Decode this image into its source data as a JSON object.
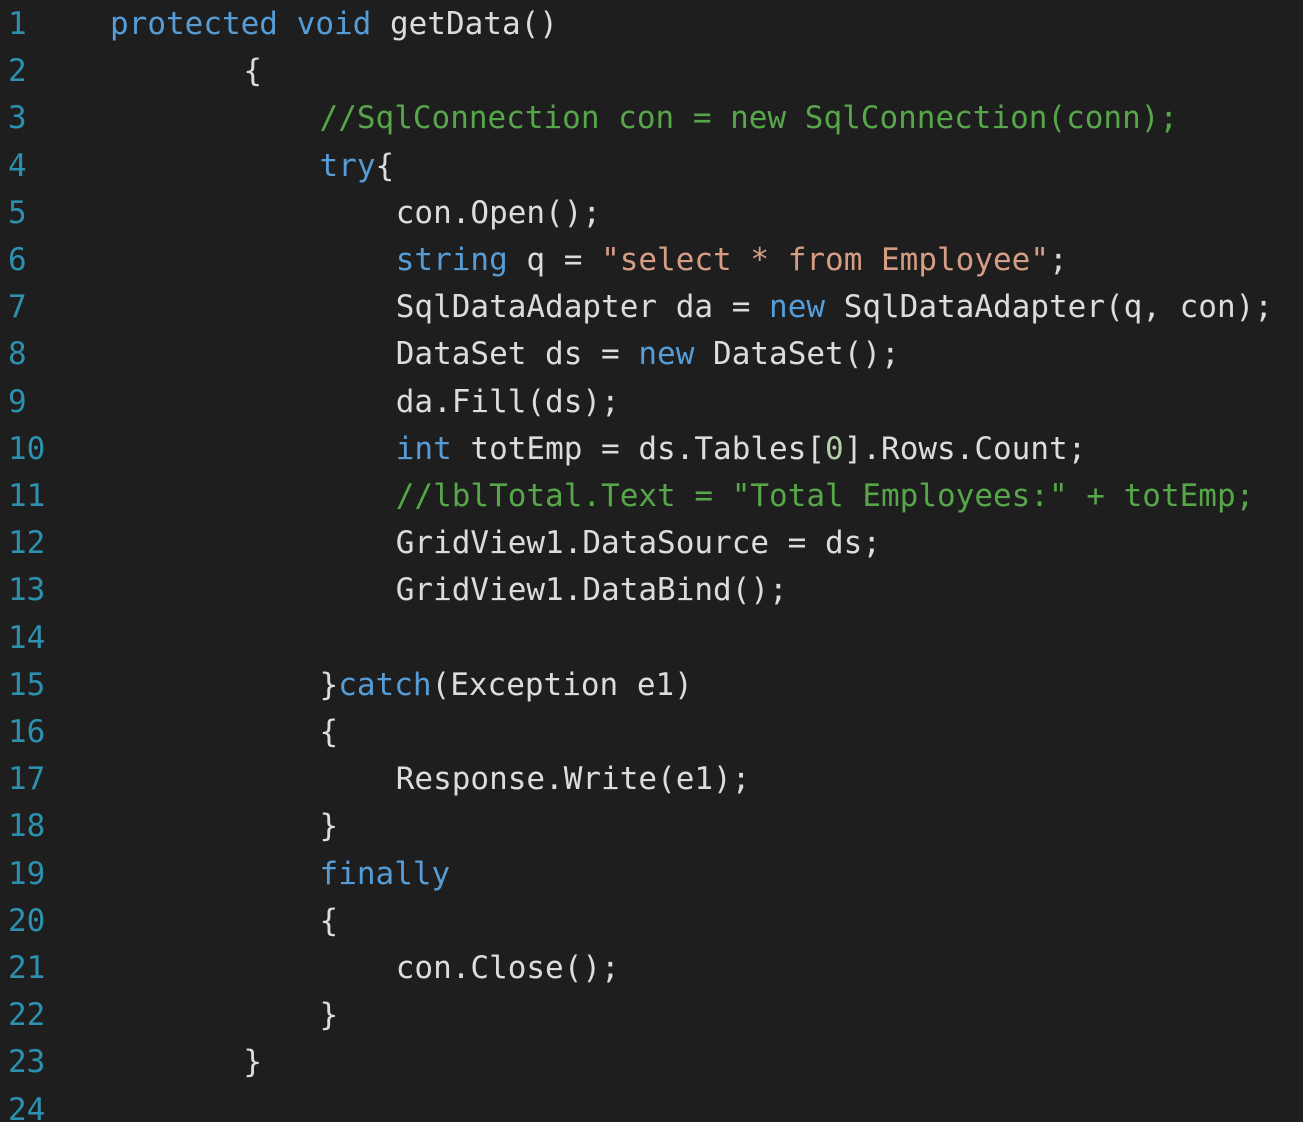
{
  "colors": {
    "background": "#1e1e1e",
    "line_number": "#2b91af",
    "plain": "#dcdcdc",
    "keyword": "#569cd6",
    "comment": "#57a64a",
    "string": "#d69d85",
    "number": "#b5cea8"
  },
  "lines": [
    {
      "number": "1",
      "indent": 0,
      "tokens": [
        {
          "t": "protected",
          "k": "kw"
        },
        {
          "t": " ",
          "k": "pl"
        },
        {
          "t": "void",
          "k": "kw"
        },
        {
          "t": " getData()",
          "k": "pl"
        }
      ]
    },
    {
      "number": "2",
      "indent": 7,
      "tokens": [
        {
          "t": "{",
          "k": "pl"
        }
      ]
    },
    {
      "number": "3",
      "indent": 11,
      "tokens": [
        {
          "t": "//SqlConnection con = new SqlConnection(conn);",
          "k": "cm"
        }
      ]
    },
    {
      "number": "4",
      "indent": 11,
      "tokens": [
        {
          "t": "try",
          "k": "kw"
        },
        {
          "t": "{",
          "k": "pl"
        }
      ]
    },
    {
      "number": "5",
      "indent": 15,
      "tokens": [
        {
          "t": "con.Open();",
          "k": "pl"
        }
      ]
    },
    {
      "number": "6",
      "indent": 15,
      "tokens": [
        {
          "t": "string",
          "k": "kw"
        },
        {
          "t": " q = ",
          "k": "pl"
        },
        {
          "t": "\"select * from Employee\"",
          "k": "str"
        },
        {
          "t": ";",
          "k": "pl"
        }
      ]
    },
    {
      "number": "7",
      "indent": 15,
      "tokens": [
        {
          "t": "SqlDataAdapter da = ",
          "k": "pl"
        },
        {
          "t": "new",
          "k": "kw"
        },
        {
          "t": " SqlDataAdapter(q, con);",
          "k": "pl"
        }
      ]
    },
    {
      "number": "8",
      "indent": 15,
      "tokens": [
        {
          "t": "DataSet ds = ",
          "k": "pl"
        },
        {
          "t": "new",
          "k": "kw"
        },
        {
          "t": " DataSet();",
          "k": "pl"
        }
      ]
    },
    {
      "number": "9",
      "indent": 15,
      "tokens": [
        {
          "t": "da.Fill(ds);",
          "k": "pl"
        }
      ]
    },
    {
      "number": "10",
      "indent": 15,
      "tokens": [
        {
          "t": "int",
          "k": "kw"
        },
        {
          "t": " totEmp = ds.Tables[",
          "k": "pl"
        },
        {
          "t": "0",
          "k": "num"
        },
        {
          "t": "].Rows.Count;",
          "k": "pl"
        }
      ]
    },
    {
      "number": "11",
      "indent": 15,
      "tokens": [
        {
          "t": "//lblTotal.Text = \"Total Employees:\" + totEmp;",
          "k": "cm"
        }
      ]
    },
    {
      "number": "12",
      "indent": 15,
      "tokens": [
        {
          "t": "GridView1.DataSource = ds;",
          "k": "pl"
        }
      ]
    },
    {
      "number": "13",
      "indent": 15,
      "tokens": [
        {
          "t": "GridView1.DataBind();",
          "k": "pl"
        }
      ]
    },
    {
      "number": "14",
      "indent": 0,
      "tokens": []
    },
    {
      "number": "15",
      "indent": 11,
      "tokens": [
        {
          "t": "}",
          "k": "pl"
        },
        {
          "t": "catch",
          "k": "kw"
        },
        {
          "t": "(Exception e1)",
          "k": "pl"
        }
      ]
    },
    {
      "number": "16",
      "indent": 11,
      "tokens": [
        {
          "t": "{",
          "k": "pl"
        }
      ]
    },
    {
      "number": "17",
      "indent": 15,
      "tokens": [
        {
          "t": "Response.Write(e1);",
          "k": "pl"
        }
      ]
    },
    {
      "number": "18",
      "indent": 11,
      "tokens": [
        {
          "t": "}",
          "k": "pl"
        }
      ]
    },
    {
      "number": "19",
      "indent": 11,
      "tokens": [
        {
          "t": "finally",
          "k": "kw"
        }
      ]
    },
    {
      "number": "20",
      "indent": 11,
      "tokens": [
        {
          "t": "{",
          "k": "pl"
        }
      ]
    },
    {
      "number": "21",
      "indent": 15,
      "tokens": [
        {
          "t": "con.Close();",
          "k": "pl"
        }
      ]
    },
    {
      "number": "22",
      "indent": 11,
      "tokens": [
        {
          "t": "}",
          "k": "pl"
        }
      ]
    },
    {
      "number": "23",
      "indent": 7,
      "tokens": [
        {
          "t": "}",
          "k": "pl"
        }
      ]
    },
    {
      "number": "24",
      "indent": 0,
      "tokens": []
    }
  ]
}
